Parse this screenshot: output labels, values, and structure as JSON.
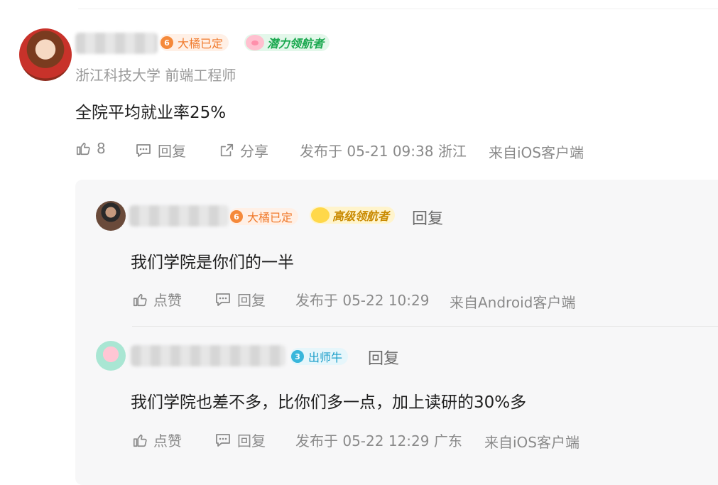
{
  "main_comment": {
    "badges": {
      "level": "6",
      "status": "大橘已定",
      "title": "潜力领航者"
    },
    "school": "浙江科技大学 前端工程师",
    "content": "全院平均就业率25%",
    "like_count": "8",
    "reply_label": "回复",
    "share_label": "分享",
    "posted": "发布于 05-21 09:38 浙江",
    "source": "来自iOS客户端"
  },
  "replies": [
    {
      "badges": {
        "level": "6",
        "status": "大橘已定",
        "title": "高级领航者"
      },
      "reply_link": "回复",
      "content": "我们学院是你们的一半",
      "like_label": "点赞",
      "reply_label": "回复",
      "posted": "发布于 05-22 10:29",
      "source": "来自Android客户端"
    },
    {
      "badges": {
        "level": "3",
        "title": "出师牛"
      },
      "reply_link": "回复",
      "content": "我们学院也差不多，比你们多一点，加上读研的30%多",
      "like_label": "点赞",
      "reply_label": "回复",
      "posted": "发布于 05-22 12:29 广东",
      "source": "来自iOS客户端"
    }
  ],
  "colors": {
    "orange_badge": "#f07a2c",
    "green_badge": "#1aa84f",
    "gold_badge": "#c98a00",
    "cyan_badge": "#1a9ec9",
    "meta_text": "#8a8a8a"
  },
  "icons": {
    "like": "thumb-up-icon",
    "reply": "comment-icon",
    "share": "share-icon"
  }
}
